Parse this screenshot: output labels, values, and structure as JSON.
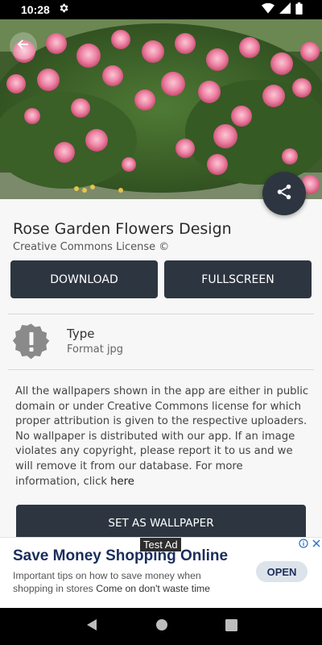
{
  "status_bar": {
    "time": "10:28",
    "icons": [
      "gear-icon",
      "wifi-icon",
      "signal-icon",
      "battery-icon"
    ]
  },
  "wallpaper": {
    "title": "Rose Garden Flowers Design",
    "license": "Creative Commons License ©"
  },
  "actions": {
    "download_label": "DOWNLOAD",
    "fullscreen_label": "FULLSCREEN",
    "set_wallpaper_label": "SET AS WALLPAPER"
  },
  "info": {
    "type_label": "Type",
    "format": "Format jpg"
  },
  "description": {
    "text": "All the wallpapers shown in the app are either in public domain or under Creative Commons license for which proper attribution is given to the respective uploaders. No wallpaper is distributed with our app. If an image violates any copyright, please report it to us and we will remove it from our database. For more information, click",
    "link": "here"
  },
  "ad": {
    "label": "Test Ad",
    "title": "Save Money Shopping Online",
    "text": "Important tips on how to save money when shopping in stores",
    "cta_text": "Come on don't waste time",
    "open_label": "OPEN"
  },
  "colors": {
    "primary_dark": "#2d3640",
    "background": "#f7f7f7",
    "ad_title": "#1a2d5c",
    "ad_choice": "#2a73c9"
  }
}
